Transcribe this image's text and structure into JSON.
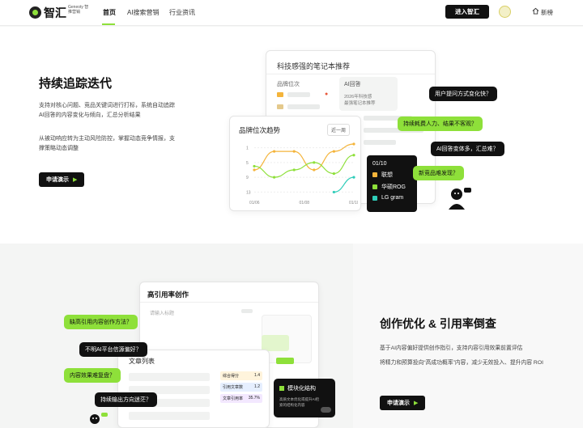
{
  "header": {
    "brand": "智汇",
    "brand_sub": "Geneoty 智推营销",
    "nav": [
      "首页",
      "AI搜索营销",
      "行业资讯"
    ],
    "active_nav": "首页",
    "enter_button": "进入智汇",
    "home_label": "新榜"
  },
  "hero": {
    "title": "持续追踪迭代",
    "desc1": "支持对核心问题、竞品关键词进行打标，系统自动追踪AI回答的内容变化与倾向，汇总分析结果",
    "desc2": "从被动响应转为主动风险防控，掌握动态竞争情报，支撑策略动态调整",
    "cta": "申请演示",
    "card_title": "科技感强的笔记本推荐",
    "col_left": "品牌位次",
    "col_right": "AI回答",
    "ai_line1": "2026年科技感",
    "ai_line2": "最强笔记本推荐",
    "chart_title": "品牌位次趋势",
    "chart_btn": "近一周",
    "bubbles": [
      "用户提问方式变化快？",
      "持续耗费人力、结果不客观？",
      "AI回答变体多，汇总难？",
      "新竞品难发现？"
    ],
    "legend": {
      "date": "01/10",
      "items": [
        {
          "label": "联想",
          "color": "#f4b43b"
        },
        {
          "label": "华硕ROG",
          "color": "#8ee03a"
        },
        {
          "label": "LG gram",
          "color": "#2fcdb9"
        }
      ]
    }
  },
  "chart_data": {
    "type": "line",
    "title": "品牌位次趋势",
    "x": [
      "01/06",
      "",
      "01/08",
      "",
      "01/10"
    ],
    "yticks": [
      "1",
      "5",
      "9",
      "13"
    ],
    "series": [
      {
        "name": "联想",
        "color": "#f4b43b",
        "values": [
          7,
          2,
          2,
          7,
          2,
          0
        ]
      },
      {
        "name": "华硕ROG",
        "color": "#8ee03a",
        "values": [
          6,
          9,
          7,
          5,
          8,
          3
        ]
      },
      {
        "name": "LG gram",
        "color": "#2fcdb9",
        "values": [
          null,
          null,
          null,
          null,
          13,
          9
        ]
      }
    ]
  },
  "section2": {
    "title": "创作优化 & 引用率倒查",
    "desc1": "基于AI内容偏好提供创作指引，支持内容引用效果前置评估",
    "desc2": "将精力和预算投向“高成功概率”内容，减少无效投入、提升内容 ROI",
    "cta": "申请演示",
    "editor_title": "高引用率创作",
    "editor_placeholder": "请输入标题",
    "list_title": "文章列表",
    "bubbles": [
      "缺高引用内容创作方法？",
      "不明AI平台信源偏好？",
      "内容效果难复盘？",
      "持续输出方向迷茫？"
    ],
    "module_title": "模块化结构",
    "module_desc": "高质文本优化或提升AI检索的结构化内容",
    "stats": [
      {
        "label": "综合得分",
        "value": "1.4"
      },
      {
        "label": "引用文章数",
        "value": "1.2"
      },
      {
        "label": "文章引用率",
        "value": "35.7%"
      }
    ]
  }
}
